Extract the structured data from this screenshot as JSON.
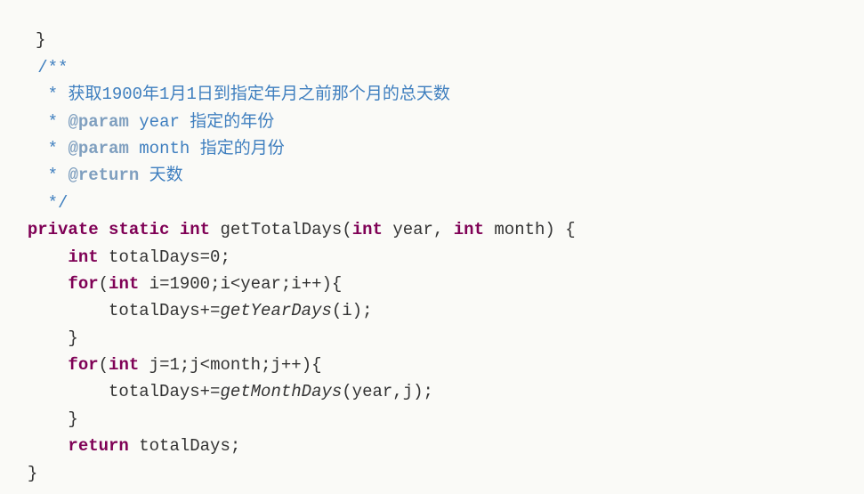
{
  "l0": "}",
  "c_open": "/**",
  "c1_star": " * ",
  "c1_text": "获取1900年1月1日到指定年月之前那个月的总天数",
  "c2_star": " * ",
  "c2_tag": "@param",
  "c2_param": " year ",
  "c2_desc": "指定的年份",
  "c3_star": " * ",
  "c3_tag": "@param",
  "c3_param": " month ",
  "c3_desc": "指定的月份",
  "c4_star": " * ",
  "c4_tag": "@return",
  "c4_desc": " 天数",
  "c_close": " */",
  "kw_private": "private",
  "kw_static": "static",
  "kw_int": "int",
  "fn_name": " getTotalDays(",
  "p1_name": " year, ",
  "p2_name": " month) {",
  "l_decl_pre": " totalDays=0;",
  "kw_for": "for",
  "loop1_open": "(",
  "loop1_init": " i=1900;i<year;i++){",
  "loop1_body_a": "        totalDays+=",
  "loop1_call": "getYearDays",
  "loop1_body_b": "(i);",
  "brace_close": "    }",
  "loop2_open": "(",
  "loop2_init": " j=1;j<month;j++){",
  "loop2_body_a": "        totalDays+=",
  "loop2_call": "getMonthDays",
  "loop2_body_b": "(year,j);",
  "kw_return": "return",
  "ret_tail": " totalDays;",
  "fn_close": "}"
}
